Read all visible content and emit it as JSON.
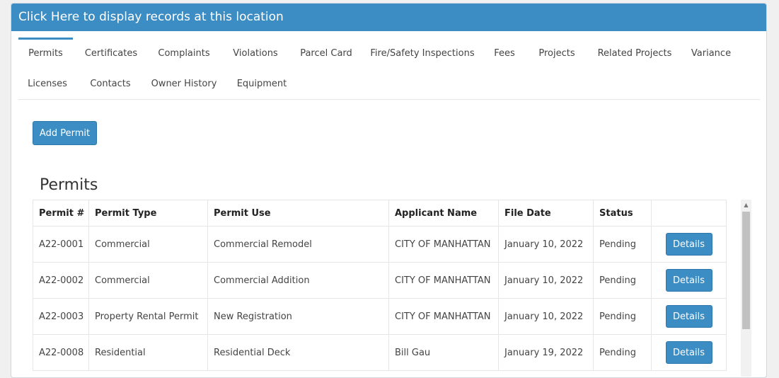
{
  "header": {
    "title": "Click Here to display records at this location"
  },
  "tabs": [
    {
      "label": "Permits",
      "active": true
    },
    {
      "label": "Certificates"
    },
    {
      "label": "Complaints"
    },
    {
      "label": "Violations"
    },
    {
      "label": "Parcel Card"
    },
    {
      "label": "Fire/Safety Inspections"
    },
    {
      "label": "Fees"
    },
    {
      "label": "Projects"
    },
    {
      "label": "Related Projects"
    },
    {
      "label": "Variance"
    },
    {
      "label": "Licenses"
    },
    {
      "label": "Contacts"
    },
    {
      "label": "Owner History"
    },
    {
      "label": "Equipment"
    }
  ],
  "actions": {
    "add_permit_label": "Add Permit"
  },
  "permits": {
    "title": "Permits",
    "columns": [
      "Permit #",
      "Permit Type",
      "Permit Use",
      "Applicant Name",
      "File Date",
      "Status",
      ""
    ],
    "rows": [
      {
        "permit_no": "A22-0001",
        "type": "Commercial",
        "use": "Commercial Remodel",
        "applicant": "CITY OF MANHATTAN",
        "file_date": "January 10, 2022",
        "status": "Pending",
        "action": "Details"
      },
      {
        "permit_no": "A22-0002",
        "type": "Commercial",
        "use": "Commercial Addition",
        "applicant": "CITY OF MANHATTAN",
        "file_date": "January 10, 2022",
        "status": "Pending",
        "action": "Details"
      },
      {
        "permit_no": "A22-0003",
        "type": "Property Rental Permit",
        "use": "New Registration",
        "applicant": "CITY OF MANHATTAN",
        "file_date": "January 10, 2022",
        "status": "Pending",
        "action": "Details"
      },
      {
        "permit_no": "A22-0008",
        "type": "Residential",
        "use": "Residential Deck",
        "applicant": "Bill Gau",
        "file_date": "January 19, 2022",
        "status": "Pending",
        "action": "Details"
      }
    ]
  },
  "scrollbar": {
    "up_icon": "triangle-up-icon"
  },
  "colors": {
    "accent": "#3c8dc4"
  }
}
